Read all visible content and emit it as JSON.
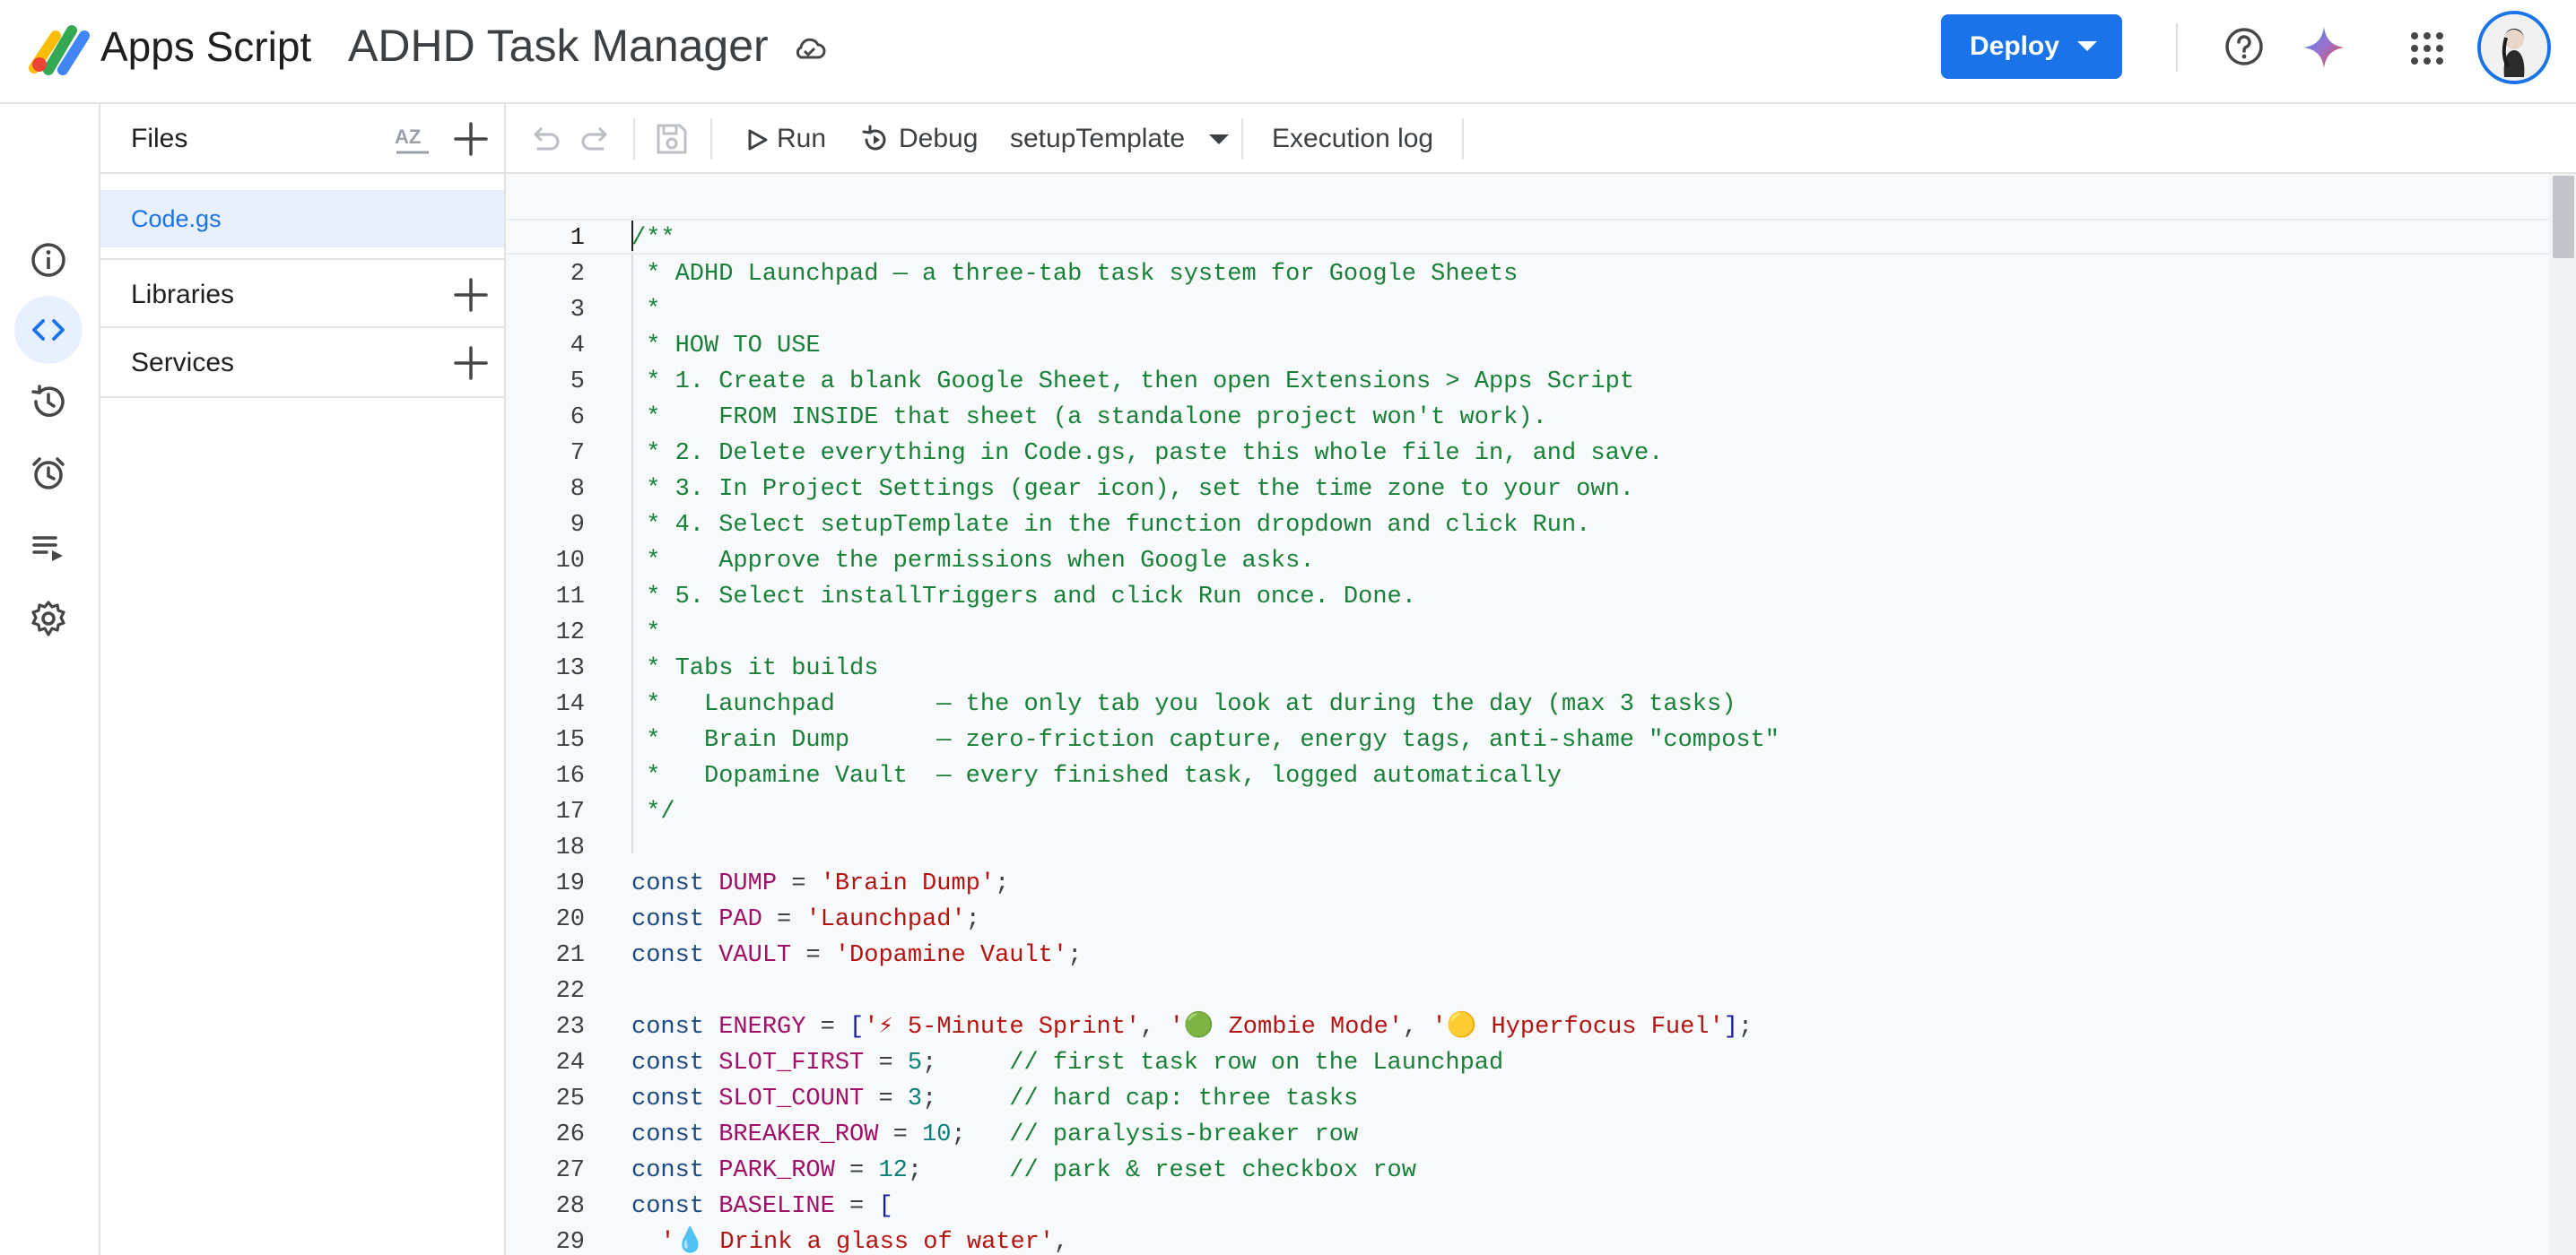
{
  "header": {
    "brand": "Apps Script",
    "project_title": "ADHD Task Manager",
    "deploy_label": "Deploy",
    "accent_color": "#1a73e8"
  },
  "rail": {
    "items": [
      {
        "name": "overview",
        "icon": "info-icon",
        "active": false
      },
      {
        "name": "editor",
        "icon": "code-icon",
        "active": true
      },
      {
        "name": "executions",
        "icon": "history-icon",
        "active": false
      },
      {
        "name": "triggers",
        "icon": "alarm-icon",
        "active": false
      },
      {
        "name": "executions-list",
        "icon": "playlist-icon",
        "active": false
      },
      {
        "name": "settings",
        "icon": "gear-icon",
        "active": false
      }
    ]
  },
  "files_panel": {
    "files_label": "Files",
    "sort_label": "AZ",
    "files": [
      "Code.gs"
    ],
    "libraries_label": "Libraries",
    "services_label": "Services"
  },
  "toolbar": {
    "run_label": "Run",
    "debug_label": "Debug",
    "function_selected": "setupTemplate",
    "execution_log_label": "Execution log"
  },
  "editor": {
    "current_line": 1,
    "lines": [
      {
        "n": "1",
        "t": [
          [
            "cm",
            "/**"
          ]
        ]
      },
      {
        "n": "2",
        "t": [
          [
            "cm",
            " * ADHD Launchpad — a three-tab task system for Google Sheets"
          ]
        ]
      },
      {
        "n": "3",
        "t": [
          [
            "cm",
            " *"
          ]
        ]
      },
      {
        "n": "4",
        "t": [
          [
            "cm",
            " * HOW TO USE"
          ]
        ]
      },
      {
        "n": "5",
        "t": [
          [
            "cm",
            " * 1. Create a blank Google Sheet, then open Extensions > Apps Script"
          ]
        ]
      },
      {
        "n": "6",
        "t": [
          [
            "cm",
            " *    FROM INSIDE that sheet (a standalone project won't work)."
          ]
        ]
      },
      {
        "n": "7",
        "t": [
          [
            "cm",
            " * 2. Delete everything in Code.gs, paste this whole file in, and save."
          ]
        ]
      },
      {
        "n": "8",
        "t": [
          [
            "cm",
            " * 3. In Project Settings (gear icon), set the time zone to your own."
          ]
        ]
      },
      {
        "n": "9",
        "t": [
          [
            "cm",
            " * 4. Select setupTemplate in the function dropdown and click Run."
          ]
        ]
      },
      {
        "n": "10",
        "t": [
          [
            "cm",
            " *    Approve the permissions when Google asks."
          ]
        ]
      },
      {
        "n": "11",
        "t": [
          [
            "cm",
            " * 5. Select installTriggers and click Run once. Done."
          ]
        ]
      },
      {
        "n": "12",
        "t": [
          [
            "cm",
            " *"
          ]
        ]
      },
      {
        "n": "13",
        "t": [
          [
            "cm",
            " * Tabs it builds"
          ]
        ]
      },
      {
        "n": "14",
        "t": [
          [
            "cm",
            " *   Launchpad       — the only tab you look at during the day (max 3 tasks)"
          ]
        ]
      },
      {
        "n": "15",
        "t": [
          [
            "cm",
            " *   Brain Dump      — zero-friction capture, energy tags, anti-shame \"compost\""
          ]
        ]
      },
      {
        "n": "16",
        "t": [
          [
            "cm",
            " *   Dopamine Vault  — every finished task, logged automatically"
          ]
        ]
      },
      {
        "n": "17",
        "t": [
          [
            "cm",
            " */"
          ]
        ]
      },
      {
        "n": "18",
        "t": []
      },
      {
        "n": "19",
        "t": [
          [
            "kw",
            "const "
          ],
          [
            "vr",
            "DUMP"
          ],
          [
            "op",
            " = "
          ],
          [
            "st",
            "'Brain Dump'"
          ],
          [
            "op",
            ";"
          ]
        ]
      },
      {
        "n": "20",
        "t": [
          [
            "kw",
            "const "
          ],
          [
            "vr",
            "PAD"
          ],
          [
            "op",
            " = "
          ],
          [
            "st",
            "'Launchpad'"
          ],
          [
            "op",
            ";"
          ]
        ]
      },
      {
        "n": "21",
        "t": [
          [
            "kw",
            "const "
          ],
          [
            "vr",
            "VAULT"
          ],
          [
            "op",
            " = "
          ],
          [
            "st",
            "'Dopamine Vault'"
          ],
          [
            "op",
            ";"
          ]
        ]
      },
      {
        "n": "22",
        "t": []
      },
      {
        "n": "23",
        "t": [
          [
            "kw",
            "const "
          ],
          [
            "vr",
            "ENERGY"
          ],
          [
            "op",
            " = "
          ],
          [
            "br",
            "["
          ],
          [
            "st",
            "'⚡ 5-Minute Sprint'"
          ],
          [
            "op",
            ", "
          ],
          [
            "st",
            "'🟢 Zombie Mode'"
          ],
          [
            "op",
            ", "
          ],
          [
            "st",
            "'🟡 Hyperfocus Fuel'"
          ],
          [
            "br",
            "]"
          ],
          [
            "op",
            ";"
          ]
        ]
      },
      {
        "n": "24",
        "t": [
          [
            "kw",
            "const "
          ],
          [
            "vr",
            "SLOT_FIRST"
          ],
          [
            "op",
            " = "
          ],
          [
            "nm",
            "5"
          ],
          [
            "op",
            ";     "
          ],
          [
            "cm",
            "// first task row on the Launchpad"
          ]
        ]
      },
      {
        "n": "25",
        "t": [
          [
            "kw",
            "const "
          ],
          [
            "vr",
            "SLOT_COUNT"
          ],
          [
            "op",
            " = "
          ],
          [
            "nm",
            "3"
          ],
          [
            "op",
            ";     "
          ],
          [
            "cm",
            "// hard cap: three tasks"
          ]
        ]
      },
      {
        "n": "26",
        "t": [
          [
            "kw",
            "const "
          ],
          [
            "vr",
            "BREAKER_ROW"
          ],
          [
            "op",
            " = "
          ],
          [
            "nm",
            "10"
          ],
          [
            "op",
            ";   "
          ],
          [
            "cm",
            "// paralysis-breaker row"
          ]
        ]
      },
      {
        "n": "27",
        "t": [
          [
            "kw",
            "const "
          ],
          [
            "vr",
            "PARK_ROW"
          ],
          [
            "op",
            " = "
          ],
          [
            "nm",
            "12"
          ],
          [
            "op",
            ";      "
          ],
          [
            "cm",
            "// park & reset checkbox row"
          ]
        ]
      },
      {
        "n": "28",
        "t": [
          [
            "kw",
            "const "
          ],
          [
            "vr",
            "BASELINE"
          ],
          [
            "op",
            " = "
          ],
          [
            "br",
            "["
          ]
        ]
      },
      {
        "n": "29",
        "t": [
          [
            "op",
            "  "
          ],
          [
            "st",
            "'💧 Drink a glass of water'"
          ],
          [
            "op",
            ","
          ]
        ]
      }
    ]
  }
}
